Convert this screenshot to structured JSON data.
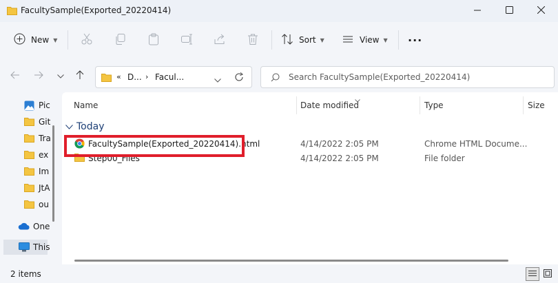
{
  "window": {
    "title": "FacultySample(Exported_20220414)",
    "minimize_icon": "minimize-icon",
    "maximize_icon": "maximize-icon",
    "close_icon": "close-icon"
  },
  "toolbar": {
    "new_label": "New",
    "sort_label": "Sort",
    "view_label": "View",
    "more_label": "···"
  },
  "address": {
    "overflow": "«",
    "crumbs": [
      "D...",
      "Facul..."
    ],
    "separator": "›"
  },
  "search": {
    "placeholder": "Search FacultySample(Exported_20220414)"
  },
  "nav": {
    "items": [
      {
        "label": "Pic",
        "icon": "pictures-icon"
      },
      {
        "label": "Git",
        "icon": "folder-icon"
      },
      {
        "label": "Tra",
        "icon": "folder-icon"
      },
      {
        "label": "ex",
        "icon": "folder-icon"
      },
      {
        "label": "Im",
        "icon": "folder-icon"
      },
      {
        "label": "JtA",
        "icon": "folder-icon"
      },
      {
        "label": "ou",
        "icon": "folder-icon"
      },
      {
        "label": "One",
        "icon": "onedrive-icon"
      },
      {
        "label": "This",
        "icon": "this-pc-icon"
      }
    ]
  },
  "columns": {
    "name": "Name",
    "date": "Date modified",
    "type": "Type",
    "size": "Size"
  },
  "group": {
    "label": "Today"
  },
  "files": [
    {
      "name": "FacultySample(Exported_20220414).html",
      "date": "4/14/2022 2:05 PM",
      "type": "Chrome HTML Docume...",
      "icon": "chrome-icon"
    },
    {
      "name": "Step00_Files",
      "date": "4/14/2022 2:05 PM",
      "type": "File folder",
      "icon": "folder-icon"
    }
  ],
  "status": {
    "count": "2 items"
  },
  "colors": {
    "highlight": "#e01e2b",
    "folder": "#f4c542",
    "group_text": "#1d3f76"
  }
}
